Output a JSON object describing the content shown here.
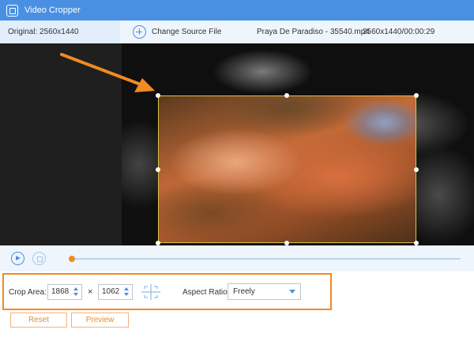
{
  "app": {
    "title": "Video Cropper"
  },
  "info": {
    "original": "Original: 2560x1440",
    "change_source": "Change Source File",
    "file_name": "Praya De Paradiso - 35540.mp4",
    "file_meta": "2560x1440/00:00:29"
  },
  "crop": {
    "label": "Crop Area:",
    "width": "1868",
    "times": "×",
    "height": "1062",
    "aspect_label": "Aspect Ratio:",
    "aspect_value": "Freely"
  },
  "buttons": {
    "reset": "Reset",
    "preview": "Preview"
  },
  "colors": {
    "accent": "#4a90e2",
    "highlight": "#f08a24"
  }
}
